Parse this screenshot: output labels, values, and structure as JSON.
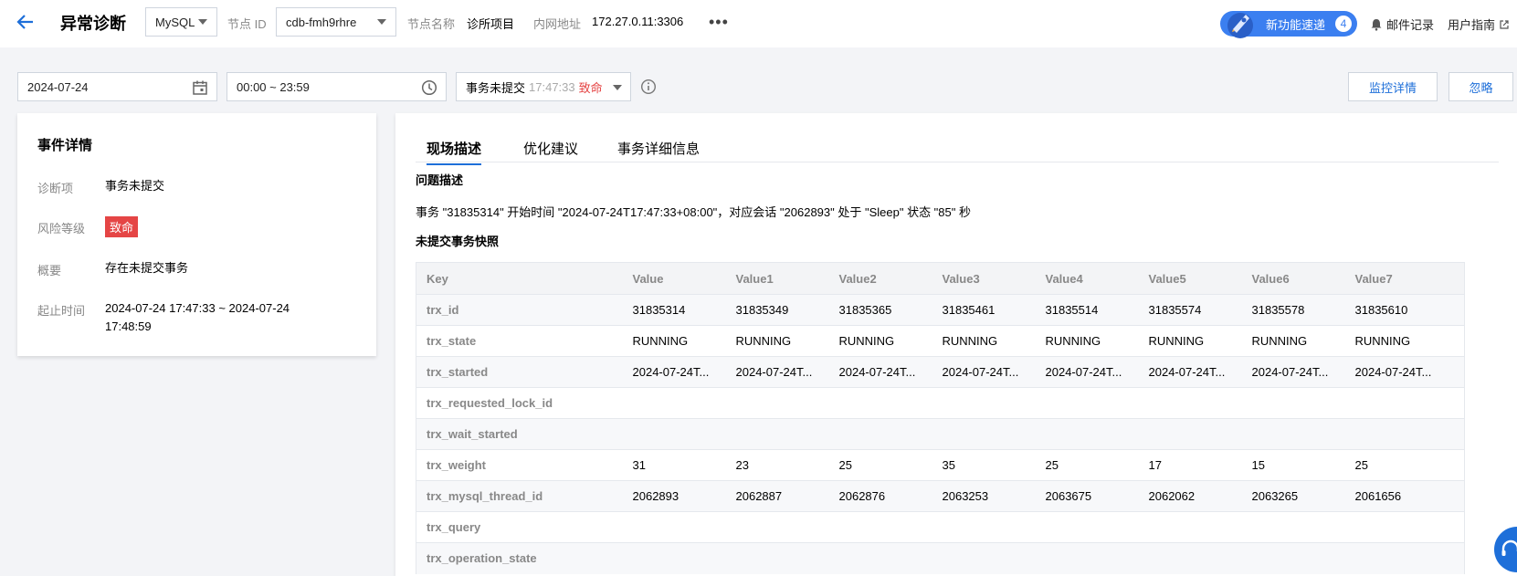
{
  "header": {
    "title": "异常诊断",
    "db_type": "MySQL",
    "node_id_label": "节点 ID",
    "node_id": "cdb-fmh9rhre",
    "node_name_label": "节点名称",
    "node_name": "诊所项目",
    "intranet_label": "内网地址",
    "intranet": "172.27.0.11:3306",
    "more": "•••",
    "new_feature_label": "新功能速递",
    "new_feature_count": "4",
    "mail_label": "邮件记录",
    "guide_label": "用户指南"
  },
  "filters": {
    "date": "2024-07-24",
    "time_range": "00:00 ~ 23:59",
    "event_name": "事务未提交",
    "event_time": "17:47:33",
    "event_level": "致命",
    "monitor_btn": "监控详情",
    "ignore_btn": "忽略"
  },
  "event": {
    "title": "事件详情",
    "diag_label": "诊断项",
    "diag_value": "事务未提交",
    "risk_label": "风险等级",
    "risk_value": "致命",
    "summary_label": "概要",
    "summary_value": "存在未提交事务",
    "time_label": "起止时间",
    "time_value": "2024-07-24 17:47:33 ~ 2024-07-24 17:48:59"
  },
  "tabs": [
    "现场描述",
    "优化建议",
    "事务详细信息"
  ],
  "problem": {
    "title": "问题描述",
    "text": "事务 \"31835314\" 开始时间 \"2024-07-24T17:47:33+08:00\"，对应会话 \"2062893\" 处于 \"Sleep\" 状态 \"85\" 秒"
  },
  "snapshot": {
    "title": "未提交事务快照",
    "columns": [
      "Key",
      "Value",
      "Value1",
      "Value2",
      "Value3",
      "Value4",
      "Value5",
      "Value6",
      "Value7"
    ],
    "rows": [
      [
        "trx_id",
        "31835314",
        "31835349",
        "31835365",
        "31835461",
        "31835514",
        "31835574",
        "31835578",
        "31835610"
      ],
      [
        "trx_state",
        "RUNNING",
        "RUNNING",
        "RUNNING",
        "RUNNING",
        "RUNNING",
        "RUNNING",
        "RUNNING",
        "RUNNING"
      ],
      [
        "trx_started",
        "2024-07-24T...",
        "2024-07-24T...",
        "2024-07-24T...",
        "2024-07-24T...",
        "2024-07-24T...",
        "2024-07-24T...",
        "2024-07-24T...",
        "2024-07-24T..."
      ],
      [
        "trx_requested_lock_id",
        "",
        "",
        "",
        "",
        "",
        "",
        "",
        ""
      ],
      [
        "trx_wait_started",
        "",
        "",
        "",
        "",
        "",
        "",
        "",
        ""
      ],
      [
        "trx_weight",
        "31",
        "23",
        "25",
        "35",
        "25",
        "17",
        "15",
        "25"
      ],
      [
        "trx_mysql_thread_id",
        "2062893",
        "2062887",
        "2062876",
        "2063253",
        "2063675",
        "2062062",
        "2063265",
        "2061656"
      ],
      [
        "trx_query",
        "",
        "",
        "",
        "",
        "",
        "",
        "",
        ""
      ],
      [
        "trx_operation_state",
        "",
        "",
        "",
        "",
        "",
        "",
        "",
        ""
      ]
    ]
  },
  "colors": {
    "accent": "#1e6fd9",
    "fatal": "#e54545",
    "pill": "#3b7ff0"
  }
}
